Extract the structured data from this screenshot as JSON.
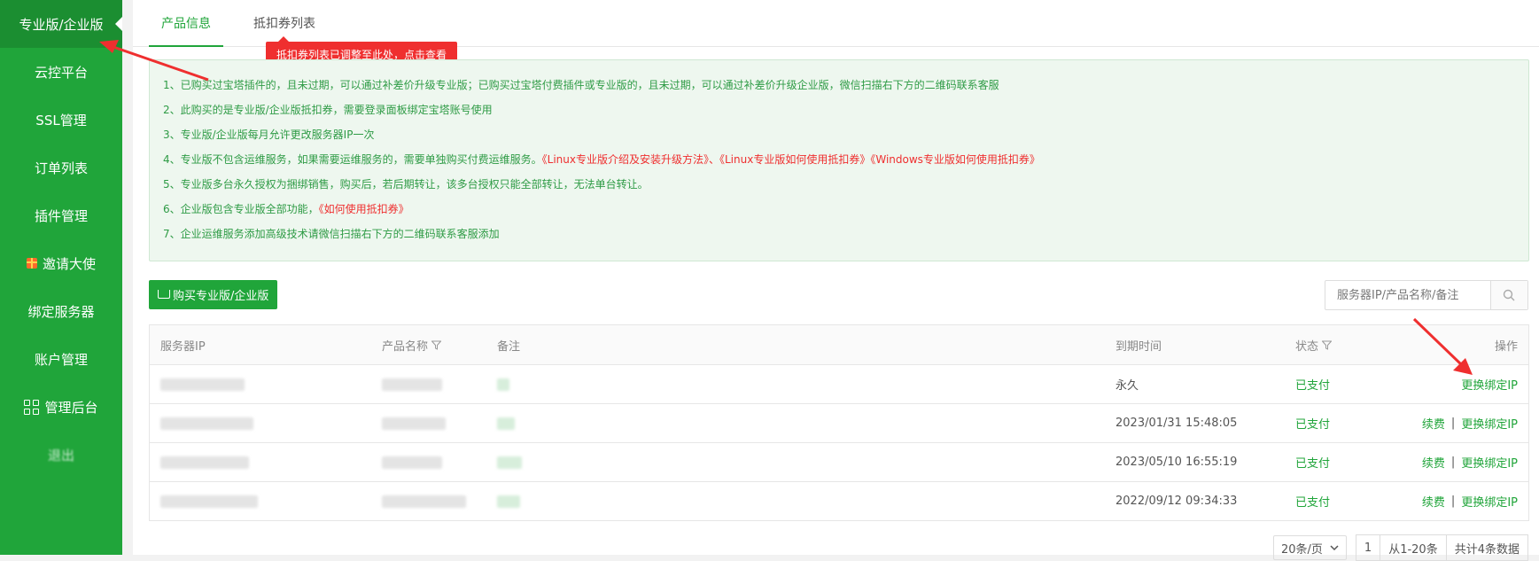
{
  "sidebar": {
    "items": [
      {
        "label": "专业版/企业版",
        "active": true
      },
      {
        "label": "云控平台"
      },
      {
        "label": "SSL管理"
      },
      {
        "label": "订单列表"
      },
      {
        "label": "插件管理"
      },
      {
        "label": "邀请大使",
        "icon": "gift-icon"
      },
      {
        "label": "绑定服务器"
      },
      {
        "label": "账户管理"
      },
      {
        "label": "管理后台",
        "icon": "grid-icon"
      },
      {
        "label": "退出"
      }
    ]
  },
  "tabs": [
    {
      "label": "产品信息",
      "active": true
    },
    {
      "label": "抵扣券列表"
    }
  ],
  "tooltip": "抵扣券列表已调整至此处，点击查看",
  "notice": {
    "line1": "1、已购买过宝塔插件的，且未过期，可以通过补差价升级专业版；已购买过宝塔付费插件或专业版的，且未过期，可以通过补差价升级企业版，微信扫描右下方的二维码联系客服",
    "line2": "2、此购买的是专业版/企业版抵扣券，需要登录面板绑定宝塔账号使用",
    "line3": "3、专业版/企业版每月允许更改服务器IP一次",
    "line4_text": "4、专业版不包含运维服务，如果需要运维服务的，需要单独购买付费运维服务。",
    "line4_link1": "《Linux专业版介绍及安装升级方法》",
    "line4_sep": "、",
    "line4_link2": "《Linux专业版如何使用抵扣券》",
    "line4_link3": "《Windows专业版如何使用抵扣券》",
    "line5": "5、专业版多台永久授权为捆绑销售，购买后，若后期转让，该多台授权只能全部转让，无法单台转让。",
    "line6_text": "6、企业版包含专业版全部功能，",
    "line6_link": "《如何使用抵扣券》",
    "line7": "7、企业运维服务添加高级技术请微信扫描右下方的二维码联系客服添加"
  },
  "buy_button": "购买专业版/企业版",
  "search": {
    "placeholder": "服务器IP/产品名称/备注"
  },
  "table": {
    "headers": {
      "ip": "服务器IP",
      "name": "产品名称",
      "note": "备注",
      "expire": "到期时间",
      "status": "状态",
      "op": "操作"
    },
    "rows": [
      {
        "expire": "永久",
        "status": "已支付",
        "renew": "",
        "rebind": "更换绑定IP"
      },
      {
        "expire": "2023/01/31 15:48:05",
        "status": "已支付",
        "renew": "续费",
        "rebind": "更换绑定IP"
      },
      {
        "expire": "2023/05/10 16:55:19",
        "status": "已支付",
        "renew": "续费",
        "rebind": "更换绑定IP"
      },
      {
        "expire": "2022/09/12 09:34:33",
        "status": "已支付",
        "renew": "续费",
        "rebind": "更换绑定IP"
      }
    ],
    "op_separator": "|"
  },
  "pagination": {
    "page_size": "20条/页",
    "page": "1",
    "range": "从1-20条",
    "total": "共计4条数据"
  },
  "colors": {
    "brand": "#20a53a",
    "brand_dark": "#1b8e31",
    "alert": "#ef2f2f",
    "notice_bg": "#eef7ef"
  }
}
